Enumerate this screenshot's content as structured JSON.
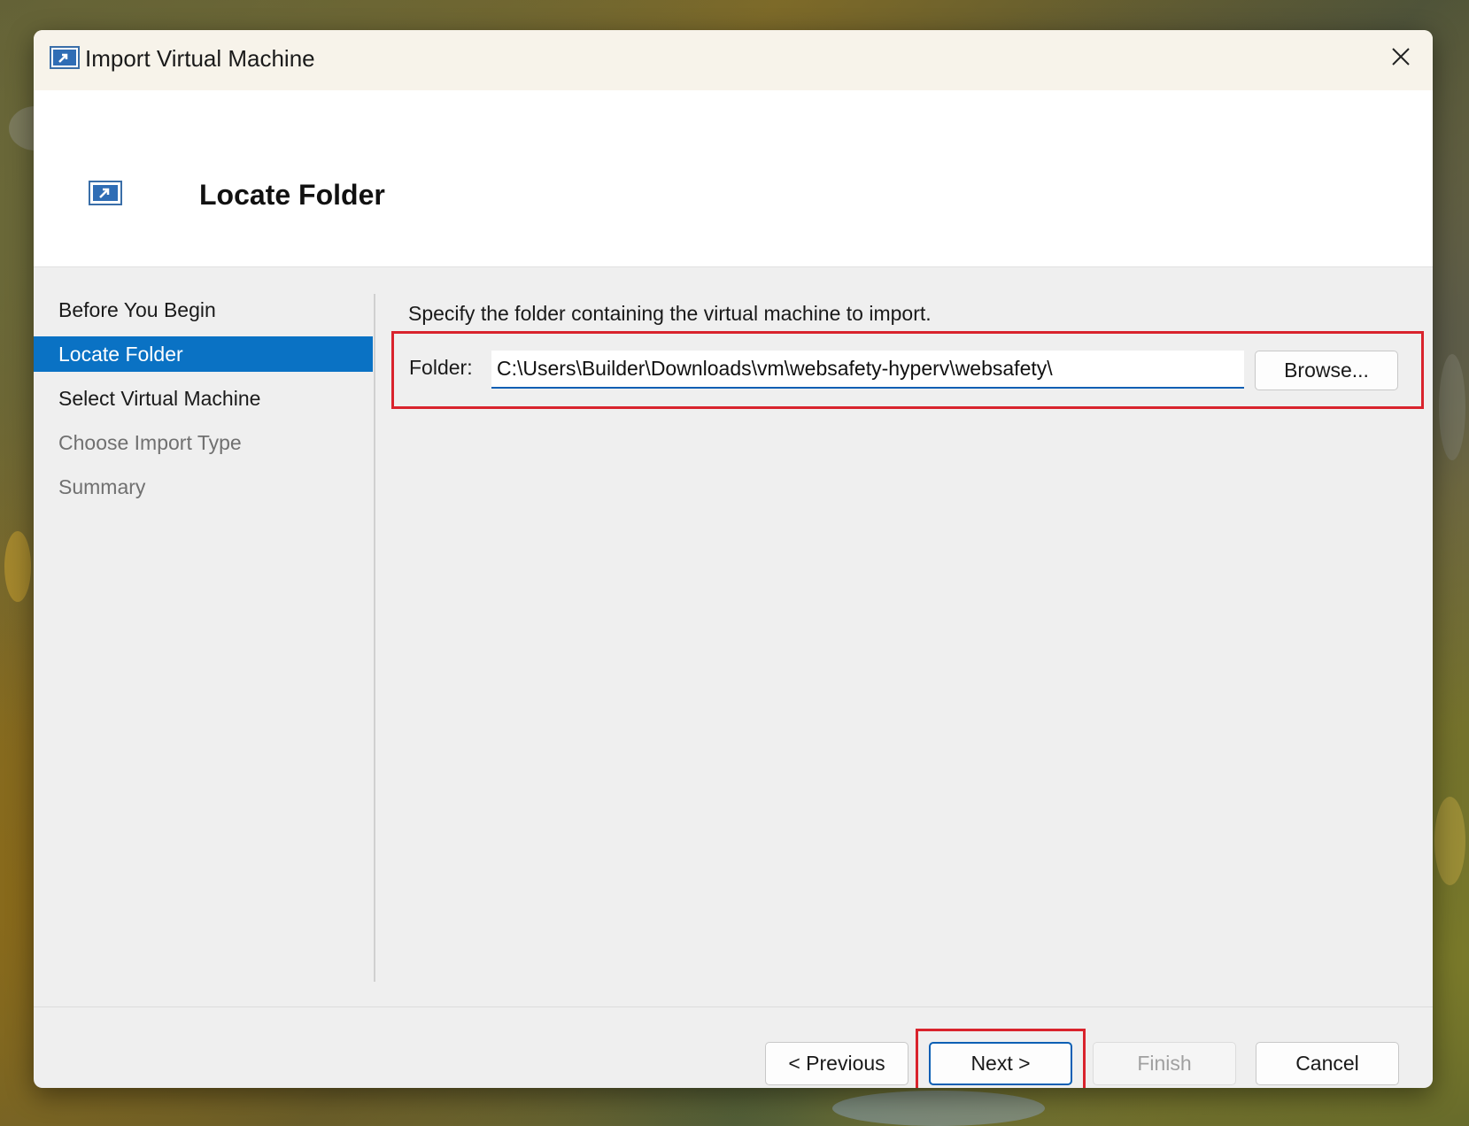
{
  "window": {
    "title": "Import Virtual Machine",
    "icon": "import-vm-icon"
  },
  "header": {
    "title": "Locate Folder"
  },
  "nav": {
    "items": [
      {
        "label": "Before You Begin",
        "state": "normal"
      },
      {
        "label": "Locate Folder",
        "state": "active"
      },
      {
        "label": "Select Virtual Machine",
        "state": "normal"
      },
      {
        "label": "Choose Import Type",
        "state": "disabled"
      },
      {
        "label": "Summary",
        "state": "disabled"
      }
    ]
  },
  "main": {
    "description": "Specify the folder containing the virtual machine to import.",
    "folder_label": "Folder:",
    "folder_value": "C:\\Users\\Builder\\Downloads\\vm\\websafety-hyperv\\websafety\\",
    "browse_label": "Browse..."
  },
  "footer": {
    "previous_label": "< Previous",
    "next_label": "Next >",
    "finish_label": "Finish",
    "cancel_label": "Cancel"
  },
  "colors": {
    "accent": "#0a72c4",
    "highlight": "#d9232d"
  }
}
